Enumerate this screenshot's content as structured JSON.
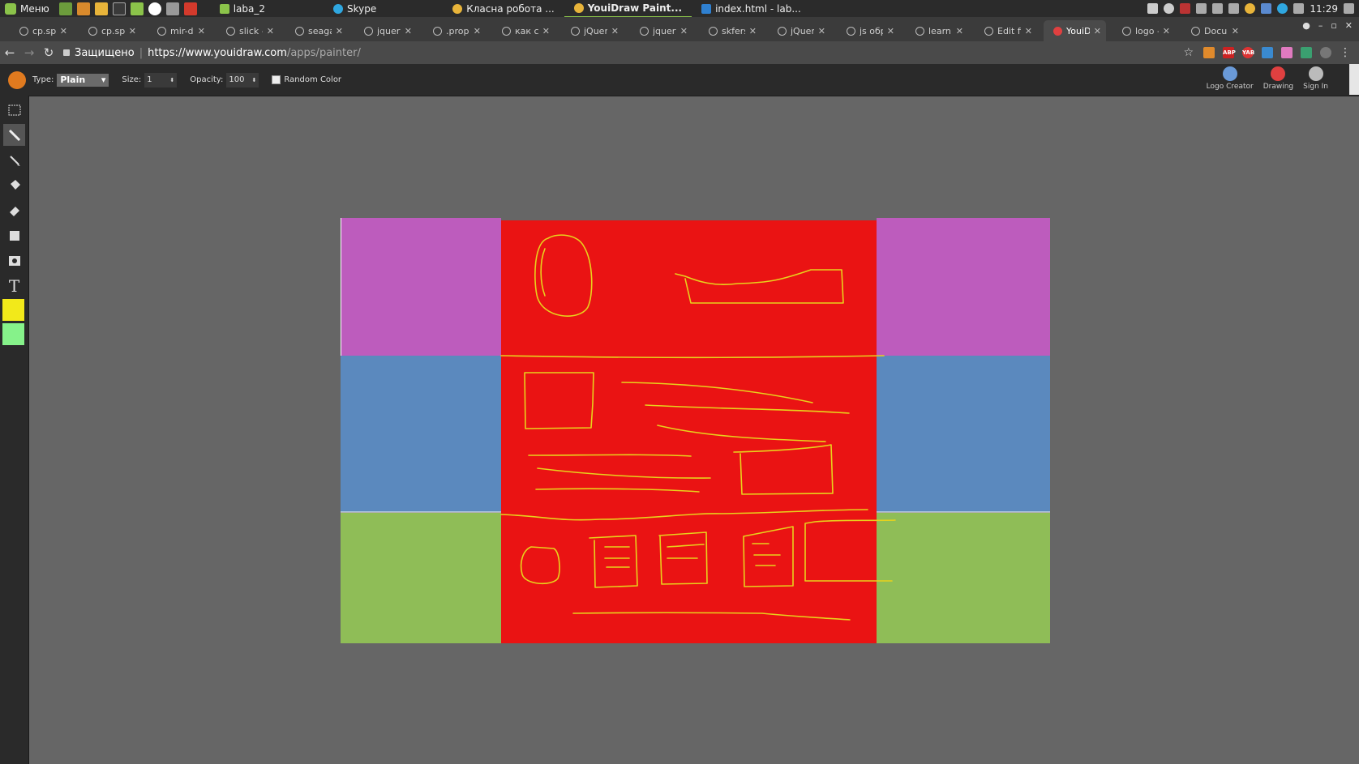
{
  "taskbar": {
    "menu_label": "Меню",
    "tasks": [
      {
        "label": "laba_2",
        "icon": "folder-icon",
        "active": false
      },
      {
        "label": "Skype",
        "icon": "skype-icon",
        "active": false
      },
      {
        "label": "Класна робота ...",
        "icon": "chrome-icon",
        "active": false
      },
      {
        "label": "YouiDraw Paint...",
        "icon": "chrome-icon",
        "active": true
      },
      {
        "label": "index.html - lab...",
        "icon": "vscode-icon",
        "active": false
      }
    ],
    "clock": "11:29"
  },
  "browser": {
    "tabs": [
      {
        "label": "cp.spr"
      },
      {
        "label": "cp.spr"
      },
      {
        "label": "mir-dv"
      },
      {
        "label": "slick -"
      },
      {
        "label": "seaga"
      },
      {
        "label": "jquery"
      },
      {
        "label": ".prop("
      },
      {
        "label": "как сд"
      },
      {
        "label": "jQuery"
      },
      {
        "label": "jquery"
      },
      {
        "label": "skfers"
      },
      {
        "label": "jQuery"
      },
      {
        "label": "js обр"
      },
      {
        "label": "learn."
      },
      {
        "label": "Edit fi"
      },
      {
        "label": "YouiD"
      },
      {
        "label": "logo -"
      },
      {
        "label": "Docur"
      }
    ],
    "active_tab_index": 15,
    "secure_label": "Защищено",
    "url_host": "https://www.youidraw.com",
    "url_path": "/apps/painter/",
    "extensions": [
      "ABP",
      "YAB"
    ]
  },
  "toolbar": {
    "type_label": "Type:",
    "type_value": "Plain",
    "size_label": "Size:",
    "size_value": "1",
    "opacity_label": "Opacity:",
    "opacity_value": "100",
    "random_color_label": "Random Color",
    "random_color_checked": false,
    "buttons": [
      {
        "label": "Logo Creator",
        "icon": "logo-creator-icon"
      },
      {
        "label": "Drawing",
        "icon": "drawing-icon"
      },
      {
        "label": "Sign In",
        "icon": "user-icon"
      }
    ]
  },
  "tools": [
    {
      "name": "select-tool",
      "icon": "marquee-icon"
    },
    {
      "name": "brush-tool",
      "icon": "brush-icon",
      "active": true
    },
    {
      "name": "pen-tool",
      "icon": "pen-icon"
    },
    {
      "name": "fill-tool",
      "icon": "bucket-icon"
    },
    {
      "name": "eraser-tool",
      "icon": "eraser-icon"
    },
    {
      "name": "shape-tool",
      "icon": "rectangle-icon"
    },
    {
      "name": "image-tool",
      "icon": "image-icon"
    },
    {
      "name": "text-tool",
      "icon": "text-icon",
      "glyph": "T"
    }
  ],
  "colors": {
    "primary": "#f2e91a",
    "secondary": "#86f28a",
    "workspace": "#666666",
    "canvas_purple": "#bd5cbd",
    "canvas_blue": "#5b89be",
    "canvas_green": "#8fbd57",
    "canvas_red": "#ea1313",
    "stroke": "#e8d21c"
  }
}
